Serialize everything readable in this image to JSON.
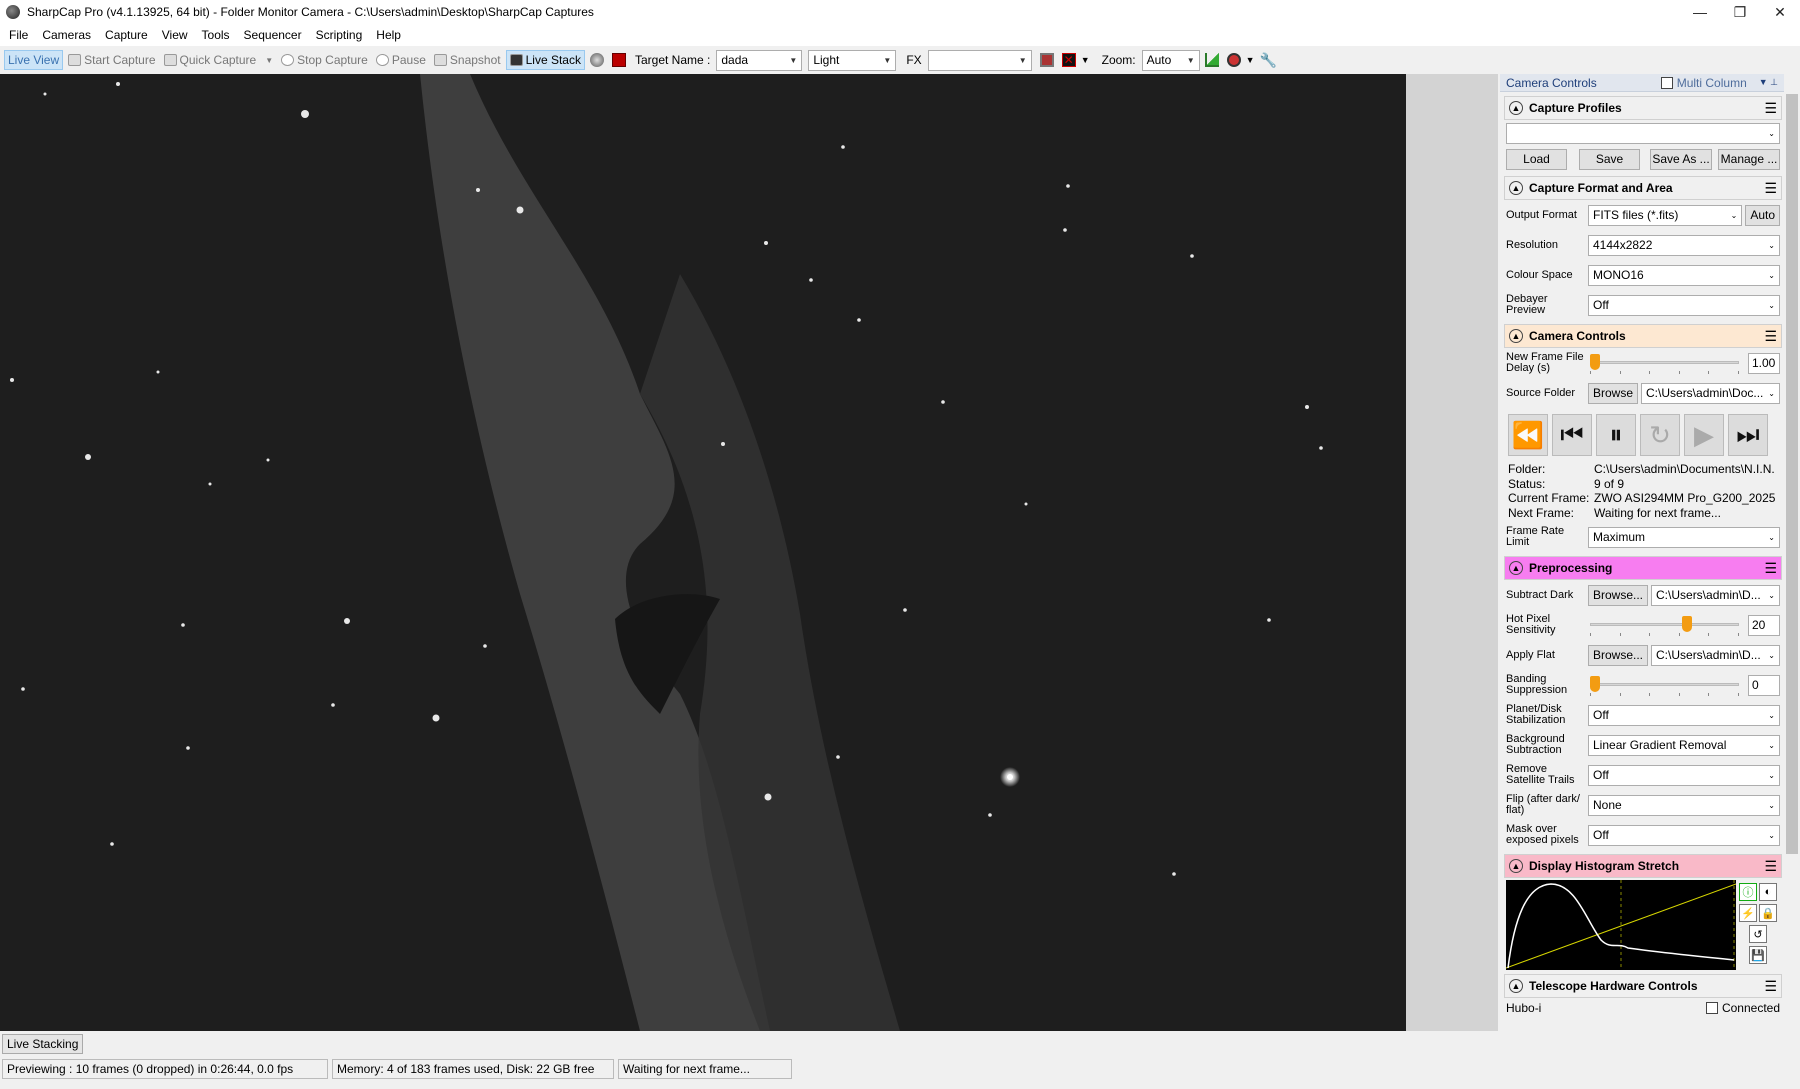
{
  "window": {
    "title": "SharpCap Pro (v4.1.13925, 64 bit) - Folder Monitor Camera - C:\\Users\\admin\\Desktop\\SharpCap Captures",
    "minimize": "—",
    "restore": "❐",
    "close": "✕"
  },
  "menu": [
    "File",
    "Cameras",
    "Capture",
    "View",
    "Tools",
    "Sequencer",
    "Scripting",
    "Help"
  ],
  "toolbar": {
    "live_view": "Live View",
    "start_capture": "Start Capture",
    "quick_capture": "Quick Capture",
    "stop_capture": "Stop Capture",
    "pause": "Pause",
    "snapshot": "Snapshot",
    "live_stack": "Live Stack",
    "target_name_label": "Target Name :",
    "target_name_value": "dada",
    "frame_type": "Light",
    "fx_label": "FX",
    "fx_value": "",
    "zoom_label": "Zoom:",
    "zoom_value": "Auto"
  },
  "camera_controls_panel": {
    "header": "Camera Controls",
    "multi_column": "Multi Column",
    "capture_profiles": {
      "title": "Capture Profiles",
      "profile_value": "",
      "load": "Load",
      "save": "Save",
      "save_as": "Save As ...",
      "manage": "Manage ..."
    },
    "capture_format": {
      "title": "Capture Format and Area",
      "output_format_label": "Output Format",
      "output_format_value": "FITS files (*.fits)",
      "auto": "Auto",
      "resolution_label": "Resolution",
      "resolution_value": "4144x2822",
      "colour_space_label": "Colour Space",
      "colour_space_value": "MONO16",
      "debayer_label": "Debayer Preview",
      "debayer_value": "Off"
    },
    "camera_controls": {
      "title": "Camera Controls",
      "new_frame_delay_label": "New Frame File Delay (s)",
      "new_frame_delay_value": "1.00",
      "new_frame_delay_level": 0.0,
      "source_folder_label": "Source Folder",
      "browse": "Browse",
      "source_folder_value": "C:\\Users\\admin\\Doc...",
      "folder_label": "Folder:",
      "folder_value": "C:\\Users\\admin\\Documents\\N.I.N.",
      "status_label": "Status:",
      "status_value": "9 of 9",
      "current_frame_label": "Current Frame:",
      "current_frame_value": "ZWO ASI294MM Pro_G200_2025",
      "next_frame_label": "Next Frame:",
      "next_frame_value": "Waiting for next frame...",
      "frame_rate_label": "Frame Rate Limit",
      "frame_rate_value": "Maximum"
    },
    "preprocessing": {
      "title": "Preprocessing",
      "subtract_dark_label": "Subtract Dark",
      "subtract_dark_browse": "Browse...",
      "subtract_dark_value": "C:\\Users\\admin\\D...",
      "hot_pixel_label": "Hot Pixel Sensitivity",
      "hot_pixel_value": "20",
      "hot_pixel_level": 0.66,
      "apply_flat_label": "Apply Flat",
      "apply_flat_browse": "Browse...",
      "apply_flat_value": "C:\\Users\\admin\\D...",
      "banding_label": "Banding Suppression",
      "banding_value": "0",
      "banding_level": 0.0,
      "planet_label": "Planet/Disk Stabilization",
      "planet_value": "Off",
      "background_label": "Background Subtraction",
      "background_value": "Linear Gradient Removal",
      "satellite_label": "Remove Satellite Trails",
      "satellite_value": "Off",
      "flip_label": "Flip (after dark/ flat)",
      "flip_value": "None",
      "mask_label": "Mask over exposed pixels",
      "mask_value": "Off"
    },
    "histogram": {
      "title": "Display Histogram Stretch"
    },
    "telescope": {
      "title": "Telescope Hardware Controls",
      "mount_value": "Hubo-i",
      "connected": "Connected"
    }
  },
  "status": {
    "tab": "Live Stacking",
    "previewing": "Previewing : 10 frames (0 dropped) in 0:26:44, 0.0 fps",
    "memory": "Memory: 4 of 183 frames used, Disk: 22 GB free",
    "waiting": "Waiting for next frame..."
  },
  "colors": {
    "accent_blue": "#cce4f7",
    "camera_controls_header": "#fde8d2",
    "preprocessing_header": "#f77df0",
    "histogram_header": "#f9b9c8",
    "slider_thumb": "#f39c12"
  }
}
